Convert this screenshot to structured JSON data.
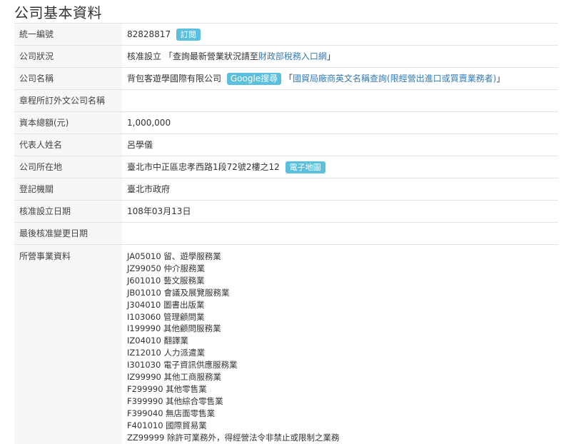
{
  "page_title": "公司基本資料",
  "rows": {
    "tax_id": {
      "label": "統一編號",
      "value": "82828817",
      "subscribe_label": "訂閱"
    },
    "status": {
      "label": "公司狀況",
      "value": "核准設立",
      "note_prefix": "「查詢最新營業狀況請至",
      "note_link": "財政部稅務入口網",
      "note_suffix": "」"
    },
    "name": {
      "label": "公司名稱",
      "value": "背包客遊學國際有限公司",
      "google_label": "Google搜尋",
      "trade_prefix": "「",
      "trade_link": "國貿局廠商英文名稱查詢(限經營出進口或買賣業務者)",
      "trade_suffix": "」"
    },
    "foreign_name": {
      "label": "章程所訂外文公司名稱",
      "value": ""
    },
    "capital": {
      "label": "資本總額(元)",
      "value": "1,000,000"
    },
    "representative": {
      "label": "代表人姓名",
      "value": "呂學儀"
    },
    "address": {
      "label": "公司所在地",
      "value": "臺北市中正區忠孝西路1段72號2樓之12",
      "map_label": "電子地圖"
    },
    "authority": {
      "label": "登記機關",
      "value": "臺北市政府"
    },
    "established": {
      "label": "核准設立日期",
      "value": "108年03月13日"
    },
    "last_change": {
      "label": "最後核准變更日期",
      "value": ""
    },
    "business": {
      "label": "所營事業資料",
      "items": [
        {
          "code": "JA05010",
          "name": "留、遊學服務業"
        },
        {
          "code": "JZ99050",
          "name": "仲介服務業"
        },
        {
          "code": "J601010",
          "name": "藝文服務業"
        },
        {
          "code": "JB01010",
          "name": "會議及展覽服務業"
        },
        {
          "code": "J304010",
          "name": "圖書出版業"
        },
        {
          "code": "I103060",
          "name": "管理顧問業"
        },
        {
          "code": "I199990",
          "name": "其他顧問服務業"
        },
        {
          "code": "IZ04010",
          "name": "翻譯業"
        },
        {
          "code": "IZ12010",
          "name": "人力派遣業"
        },
        {
          "code": "I301030",
          "name": "電子資訊供應服務業"
        },
        {
          "code": "IZ99990",
          "name": "其他工商服務業"
        },
        {
          "code": "F299990",
          "name": "其他零售業"
        },
        {
          "code": "F399990",
          "name": "其他綜合零售業"
        },
        {
          "code": "F399040",
          "name": "無店面零售業"
        },
        {
          "code": "F401010",
          "name": "國際貿易業"
        },
        {
          "code": "ZZ99999",
          "name": "除許可業務外，得經營法令非禁止或限制之業務"
        }
      ]
    }
  },
  "colors": {
    "badge": "#5bc0de",
    "link": "#337ab7",
    "label_bg": "#f7f7f7",
    "border": "#e3e3e3"
  }
}
